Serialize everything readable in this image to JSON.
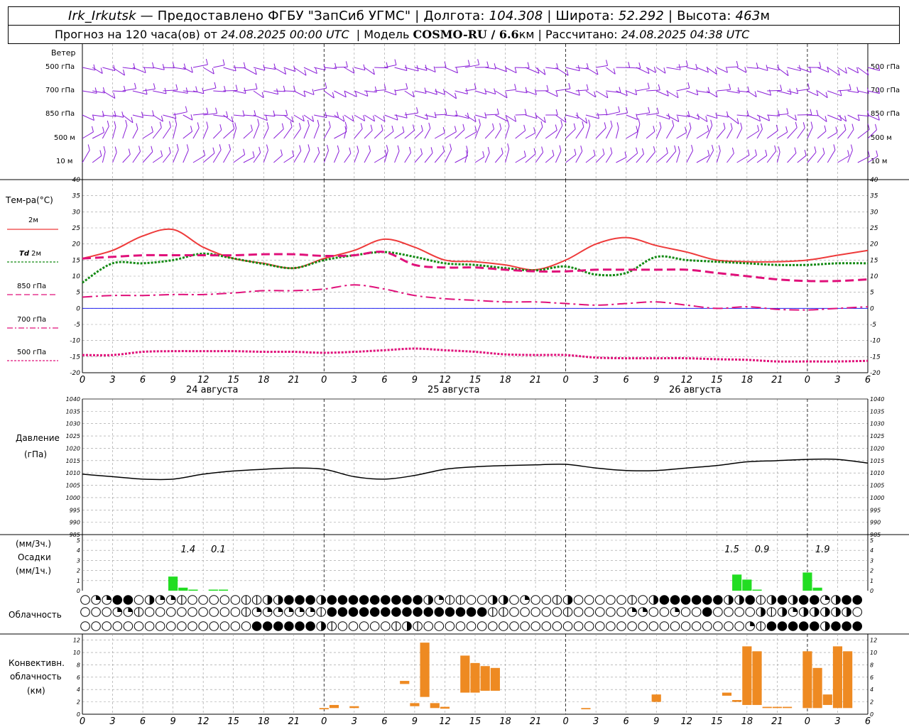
{
  "header": {
    "station": "Irk_Irkutsk",
    "provider": "— Предоставлено ФГБУ \"ЗапСиб УГМС\"",
    "lon_label": "Долгота:",
    "lon": "104.308",
    "lat_label": "Широта:",
    "lat": "52.292",
    "alt_label": "Высота:",
    "alt": "463",
    "alt_unit": "м",
    "forecast_prefix": "Прогноз на 120 часа(ов)  от",
    "forecast_start": "24.08.2025 00:00 UTC",
    "model_label": "Модель",
    "model": "COSMO-RU / 6.6",
    "model_unit": "км",
    "computed_label": "Рассчитано:",
    "computed": "24.08.2025 04:38 UTC"
  },
  "labels": {
    "wind": "Ветер",
    "levels": [
      "500 гПа",
      "700 гПа",
      "850 гПа",
      "500 м",
      "10 м"
    ],
    "temp_title": "Тем-ра(°С)",
    "t2m": "2м",
    "td": "Td",
    "td2m": "2м",
    "l850": "850 гПа",
    "l700": "700 гПа",
    "l500": "500 гПа",
    "pressure": "Давление",
    "pressure_unit": "(гПа)",
    "precip_unit_top": "(мм/3ч.)",
    "precip": "Осадки",
    "precip_unit_bottom": "(мм/1ч.)",
    "cloud": "Облачность",
    "conv1": "Конвективн.",
    "conv2": "облачность",
    "conv3": "(км)",
    "days": [
      "24 августа",
      "25 августа",
      "26 августа"
    ]
  },
  "colors": {
    "t2m": "#ee3b3b",
    "td": "#138a13",
    "levels": "#e0107a",
    "wind": "#8a1ed8",
    "precip": "#22dd22",
    "conv": "#ee8a22",
    "zero": "#0000ee"
  },
  "chart_data": [
    {
      "type": "line",
      "title": "Тем-ра(°С)",
      "ylim": [
        -20,
        40
      ],
      "x_ticks": [
        "0",
        "3",
        "6",
        "9",
        "12",
        "15",
        "18",
        "21",
        "0",
        "3",
        "6",
        "9",
        "12",
        "15",
        "18",
        "21",
        "0",
        "3",
        "6",
        "9",
        "12",
        "15",
        "18",
        "21",
        "0",
        "3",
        "6"
      ],
      "x": [
        0,
        3,
        6,
        9,
        12,
        15,
        18,
        21,
        24,
        27,
        30,
        33,
        36,
        39,
        42,
        45,
        48,
        51,
        54,
        57,
        60,
        63,
        66,
        69,
        72,
        75,
        78
      ],
      "series": [
        {
          "name": "2м",
          "values": [
            15.5,
            18,
            22.5,
            24.5,
            19,
            15.5,
            14,
            12.5,
            15.5,
            18,
            21.5,
            19,
            15,
            14.5,
            13.5,
            12,
            15,
            20,
            22,
            19.5,
            17.5,
            15,
            14.5,
            14.5,
            15,
            16.5,
            18
          ]
        },
        {
          "name": "Td 2м",
          "values": [
            8,
            14,
            14,
            15,
            17,
            15.5,
            13.8,
            12.5,
            15,
            16.5,
            17.5,
            16,
            14,
            13.5,
            12.5,
            11.8,
            13,
            10.5,
            11,
            16,
            15,
            14.5,
            14,
            13.5,
            13.5,
            14,
            14
          ]
        },
        {
          "name": "850 гПа",
          "values": [
            15.5,
            16,
            16.5,
            16.5,
            16.5,
            16.5,
            16.8,
            16.8,
            16.3,
            16.5,
            17.5,
            13.5,
            12.7,
            12.7,
            12,
            11.5,
            11.5,
            12,
            12,
            12,
            12,
            11,
            10,
            9,
            8.5,
            8.5,
            9
          ]
        },
        {
          "name": "700 гПа",
          "values": [
            3.5,
            4,
            4,
            4.3,
            4.3,
            4.8,
            5.5,
            5.5,
            6,
            7.3,
            6,
            4,
            3,
            2.5,
            2,
            2,
            1.5,
            1,
            1.5,
            2,
            1,
            0,
            0.5,
            -0.3,
            -0.5,
            0,
            0.5
          ]
        },
        {
          "name": "500 гПа",
          "values": [
            -14.5,
            -14.5,
            -13.5,
            -13.3,
            -13.3,
            -13.3,
            -13.5,
            -13.5,
            -13.8,
            -13.5,
            -13,
            -12.5,
            -13,
            -13.5,
            -14.3,
            -14.5,
            -14.5,
            -15.3,
            -15.5,
            -15.5,
            -15.5,
            -15.8,
            -16,
            -16.5,
            -16.5,
            -16.5,
            -16.3
          ]
        }
      ]
    },
    {
      "type": "line",
      "title": "Давление (гПа)",
      "ylim": [
        985,
        1040
      ],
      "x": [
        0,
        3,
        6,
        9,
        12,
        15,
        18,
        21,
        24,
        27,
        30,
        33,
        36,
        39,
        42,
        45,
        48,
        51,
        54,
        57,
        60,
        63,
        66,
        69,
        72,
        75,
        78
      ],
      "series": [
        {
          "name": "Давление",
          "values": [
            1009.5,
            1008.5,
            1007.5,
            1007.5,
            1009.5,
            1010.8,
            1011.5,
            1012,
            1011.5,
            1008.5,
            1007.5,
            1009,
            1011.5,
            1012.5,
            1013,
            1013.3,
            1013.5,
            1012,
            1011,
            1011,
            1012,
            1013,
            1014.5,
            1015,
            1015.5,
            1015.5,
            1014
          ]
        }
      ]
    },
    {
      "type": "bar",
      "title": "Осадки",
      "ylim": [
        0,
        5
      ],
      "annotations": [
        {
          "x": 10.5,
          "text": "1.4"
        },
        {
          "x": 13.5,
          "text": "0.1"
        },
        {
          "x": 64.5,
          "text": "1.5"
        },
        {
          "x": 67.5,
          "text": "0.9"
        },
        {
          "x": 73.5,
          "text": "1.9"
        }
      ],
      "bars": [
        {
          "x": 9,
          "value": 1.4
        },
        {
          "x": 10,
          "value": 0.3
        },
        {
          "x": 11,
          "value": 0.1
        },
        {
          "x": 13,
          "value": 0.05
        },
        {
          "x": 14,
          "value": 0.05
        },
        {
          "x": 65,
          "value": 1.6
        },
        {
          "x": 66,
          "value": 1.1
        },
        {
          "x": 67,
          "value": 0.1
        },
        {
          "x": 72,
          "value": 1.8
        },
        {
          "x": 73,
          "value": 0.3
        }
      ]
    },
    {
      "type": "bar",
      "title": "Конвективн. облачность (км)",
      "ylim": [
        0,
        13
      ],
      "bars": [
        {
          "x": 24,
          "lo": 0.8,
          "hi": 1.0
        },
        {
          "x": 25,
          "lo": 1.0,
          "hi": 1.5
        },
        {
          "x": 27,
          "lo": 1.0,
          "hi": 1.3
        },
        {
          "x": 32,
          "lo": 4.9,
          "hi": 5.4
        },
        {
          "x": 33,
          "lo": 1.3,
          "hi": 1.8
        },
        {
          "x": 34,
          "lo": 2.8,
          "hi": 11.6
        },
        {
          "x": 35,
          "lo": 1.0,
          "hi": 1.8
        },
        {
          "x": 36,
          "lo": 0.9,
          "hi": 1.2
        },
        {
          "x": 38,
          "lo": 3.5,
          "hi": 9.5
        },
        {
          "x": 39,
          "lo": 3.5,
          "hi": 8.3
        },
        {
          "x": 40,
          "lo": 3.8,
          "hi": 7.8
        },
        {
          "x": 41,
          "lo": 3.8,
          "hi": 7.5
        },
        {
          "x": 50,
          "lo": 0.8,
          "hi": 1.0
        },
        {
          "x": 57,
          "lo": 2.0,
          "hi": 3.2
        },
        {
          "x": 64,
          "lo": 3.0,
          "hi": 3.5
        },
        {
          "x": 65,
          "lo": 2.0,
          "hi": 2.3
        },
        {
          "x": 66,
          "lo": 1.5,
          "hi": 11.0
        },
        {
          "x": 67,
          "lo": 1.5,
          "hi": 10.2
        },
        {
          "x": 68,
          "lo": 1.0,
          "hi": 1.2
        },
        {
          "x": 69,
          "lo": 1.0,
          "hi": 1.2
        },
        {
          "x": 70,
          "lo": 1.0,
          "hi": 1.2
        },
        {
          "x": 72,
          "lo": 1.0,
          "hi": 10.2
        },
        {
          "x": 73,
          "lo": 1.0,
          "hi": 7.5
        },
        {
          "x": 74,
          "lo": 1.5,
          "hi": 3.2
        },
        {
          "x": 75,
          "lo": 1.0,
          "hi": 11.0
        },
        {
          "x": 76,
          "lo": 1.0,
          "hi": 10.2
        }
      ]
    },
    {
      "type": "table",
      "title": "Облачность",
      "rows": [
        "0224403221000001133444344444444432110033020013000001034444443341343442344",
        "0002210000000001222222144444444444444411000001000002200200400003132333330",
        "0000000000000000444444310000013100000000000000000000000000000021444443444"
      ]
    }
  ]
}
